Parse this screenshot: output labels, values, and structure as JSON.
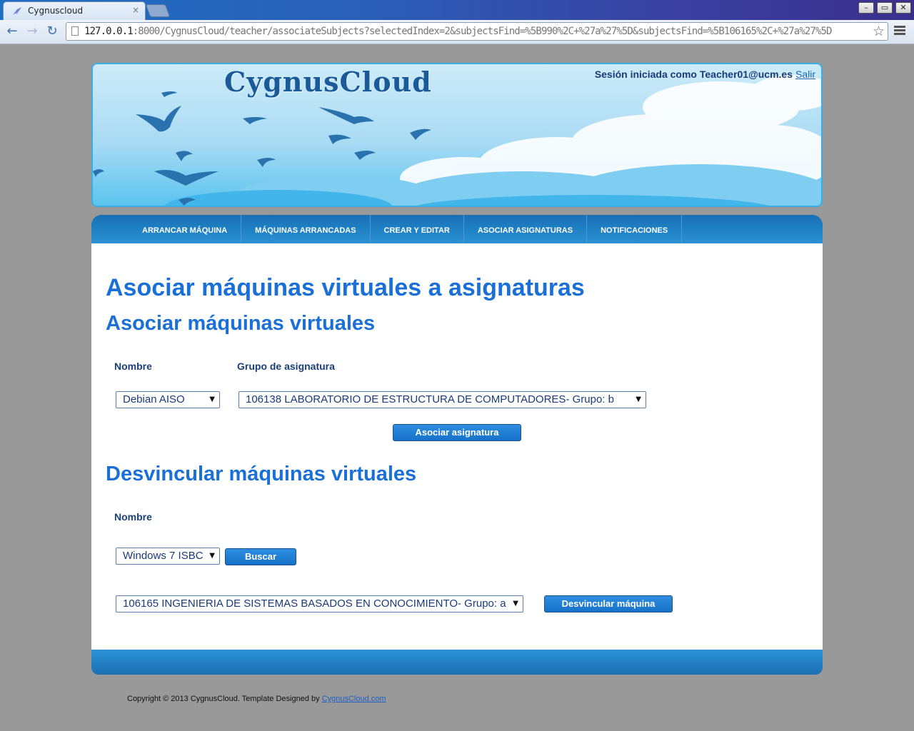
{
  "browser": {
    "tab_title": "Cygnuscloud",
    "tab_close": "×",
    "url_host": "127.0.0.1",
    "url_rest": ":8000/CygnusCloud/teacher/associateSubjects?selectedIndex=2&subjectsFind=%5B990%2C+%27a%27%5D&subjectsFind=%5B106165%2C+%27a%27%5D",
    "back": "←",
    "forward": "→",
    "reload": "↻",
    "star": "☆",
    "win_min": "–",
    "win_max": "▭",
    "win_close": "✕"
  },
  "header": {
    "logo": "CygnusCloud",
    "session_text": "Sesión iniciada como Teacher01@ucm.es",
    "logout": "Salir"
  },
  "nav": {
    "items": [
      "ARRANCAR MÁQUINA",
      "MÁQUINAS ARRANCADAS",
      "CREAR Y EDITAR",
      "ASOCIAR ASIGNATURAS",
      "NOTIFICACIONES"
    ]
  },
  "main": {
    "title": "Asociar máquinas virtuales a asignaturas",
    "associate": {
      "heading": "Asociar máquinas virtuales",
      "name_label": "Nombre",
      "group_label": "Grupo de asignatura",
      "name_selected": "Debian AISO",
      "group_selected": "106138 LABORATORIO DE ESTRUCTURA DE COMPUTADORES- Grupo: b",
      "button": "Asociar asignatura"
    },
    "unlink": {
      "heading": "Desvincular máquinas virtuales",
      "name_label": "Nombre",
      "name_selected": "Windows 7 ISBC",
      "search_button": "Buscar",
      "subject_selected": "106165 INGENIERIA DE SISTEMAS BASADOS EN CONOCIMIENTO- Grupo: a",
      "unlink_button": "Desvincular máquina"
    }
  },
  "footer": {
    "copyright": "Copyright © 2013 CygnusCloud. Template Designed by",
    "link": "CygnusCloud.com"
  }
}
